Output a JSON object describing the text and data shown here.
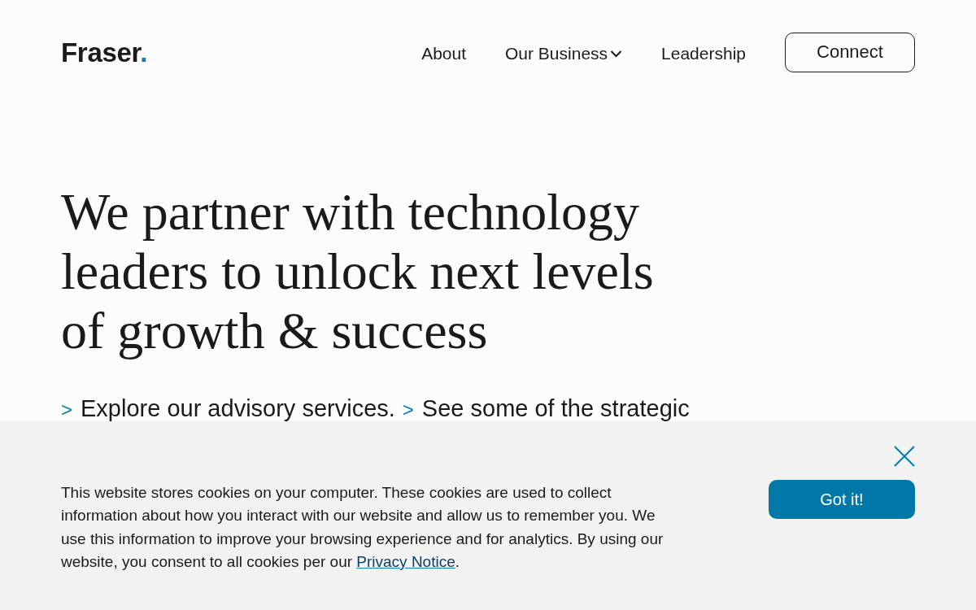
{
  "header": {
    "logo": {
      "name": "Fraser",
      "mark": "."
    },
    "nav": [
      {
        "label": "About",
        "kind": "link"
      },
      {
        "label": "Our Business",
        "kind": "dropdown"
      },
      {
        "label": "Leadership",
        "kind": "link"
      }
    ],
    "cta": "Connect"
  },
  "hero": {
    "headline": "We partner with technology leaders to unlock next levels of growth & success",
    "links": [
      {
        "arrow": ">",
        "text": "Explore our advisory services."
      },
      {
        "arrow": ">",
        "text": "See some of the strategic"
      }
    ]
  },
  "cookie_banner": {
    "lines": [
      "This website stores cookies on your computer. These cookies are used to collect",
      "information about how you interact with our website and allow us to remember you. We",
      "use this information to improve your browsing experience and for analytics. By using our",
      "website, you consent to all cookies per our "
    ],
    "link": "Privacy Notice",
    "text_end": ".",
    "button": "Got it!"
  }
}
